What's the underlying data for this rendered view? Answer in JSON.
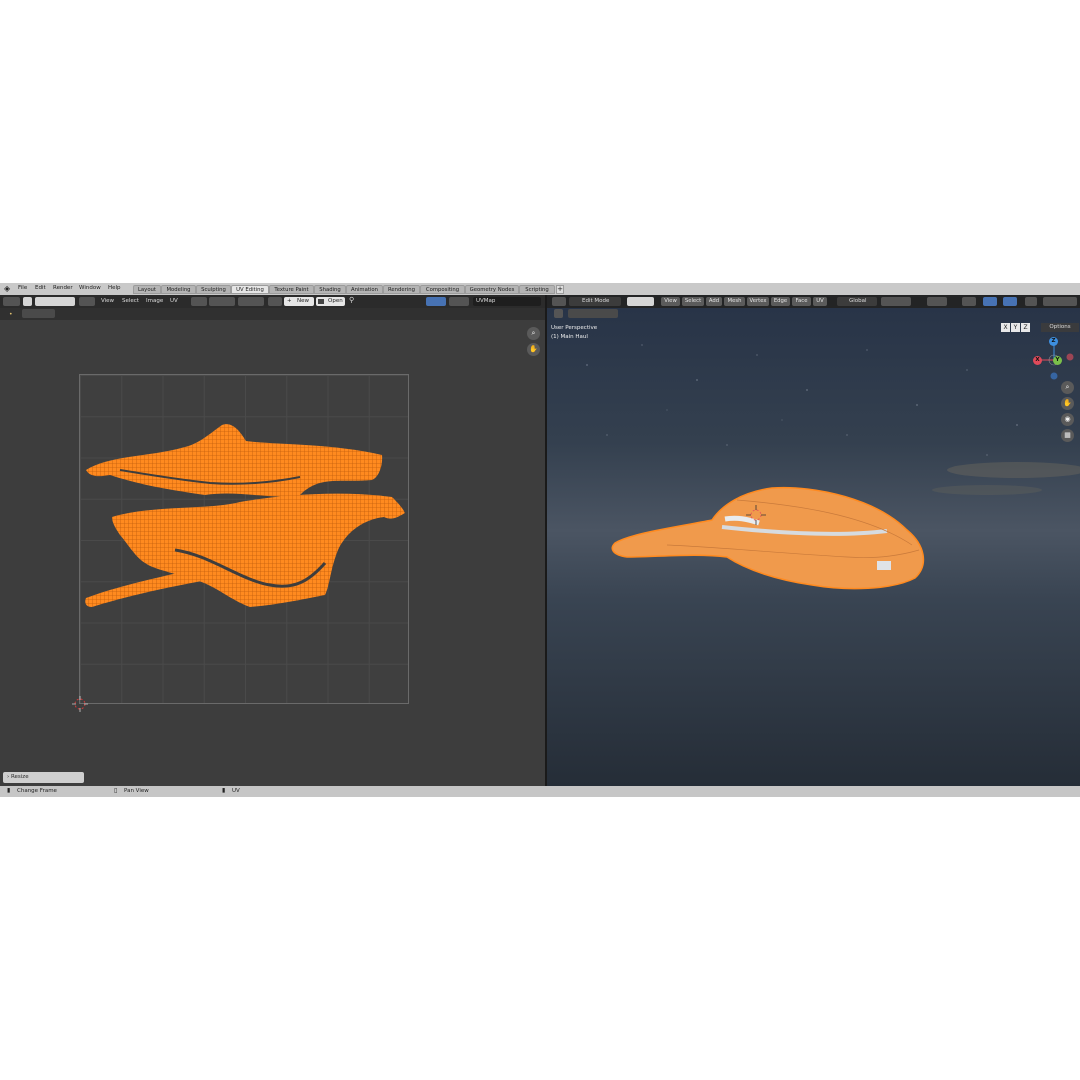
{
  "menubar": {
    "items": [
      "File",
      "Edit",
      "Render",
      "Window",
      "Help"
    ]
  },
  "workspaces": {
    "tabs": [
      "Layout",
      "Modeling",
      "Sculpting",
      "UV Editing",
      "Texture Paint",
      "Shading",
      "Animation",
      "Rendering",
      "Compositing",
      "Geometry Nodes",
      "Scripting"
    ],
    "active": "UV Editing",
    "add_label": "+"
  },
  "uv_editor": {
    "menu": [
      "View",
      "Select",
      "Image",
      "UV"
    ],
    "new_label": "New",
    "open_label": "Open",
    "uvmap_name": "UVMap",
    "resize_panel_label": "Resize",
    "accent_color": "#ff8a1f"
  },
  "viewport": {
    "mode": "Edit Mode",
    "menu": [
      "View",
      "Select",
      "Add",
      "Mesh",
      "Vertex",
      "Edge",
      "Face",
      "UV"
    ],
    "orientation": "Global",
    "perspective_label": "User Perspective",
    "object_label": "(1) Main Haul",
    "mirror_axes": [
      "X",
      "Y",
      "Z"
    ],
    "options_label": "Options",
    "gizmo_axes": {
      "x": "X",
      "y": "Y",
      "z": "Z"
    },
    "gizmo_colors": {
      "x": "#e04a5a",
      "y": "#7ac04a",
      "z": "#3d8fe0"
    }
  },
  "statusbar": {
    "items": [
      "Change Frame",
      "Pan View",
      "UV"
    ]
  },
  "icons": [
    "blender-logo-icon",
    "editor-type-icon",
    "select-mode-icon",
    "zoom-icon",
    "hand-pan-icon",
    "camera-icon",
    "grid-icon",
    "pin-icon"
  ]
}
